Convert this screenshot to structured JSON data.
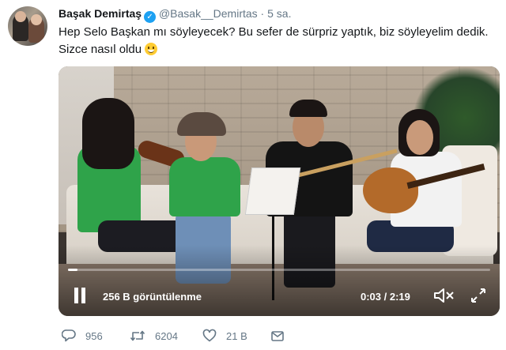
{
  "tweet": {
    "author_name": "Başak Demirtaş",
    "handle": "@Basak__Demirtas",
    "separator": "·",
    "time": "5 sa.",
    "text": "Hep Selo Başkan mı söyleyecek? Bu sefer de sürpriz yaptık, biz söyleyelim dedik. Sizce nasıl oldu"
  },
  "video": {
    "views": "256 B görüntülenme",
    "timecode": "0:03 / 2:19",
    "progress_fraction": 0.023
  },
  "actions": {
    "replies": "956",
    "retweets": "6204",
    "likes": "21 B"
  },
  "icons": {
    "verified": "verified-badge-icon",
    "emoji": "grinning-emoji-icon",
    "pause": "pause-icon",
    "mute": "speaker-muted-icon",
    "fullscreen": "fullscreen-icon",
    "reply": "reply-icon",
    "retweet": "retweet-icon",
    "like": "heart-icon",
    "message": "envelope-icon"
  },
  "colors": {
    "verified_blue": "#1da1f2",
    "secondary_text": "#657786"
  }
}
